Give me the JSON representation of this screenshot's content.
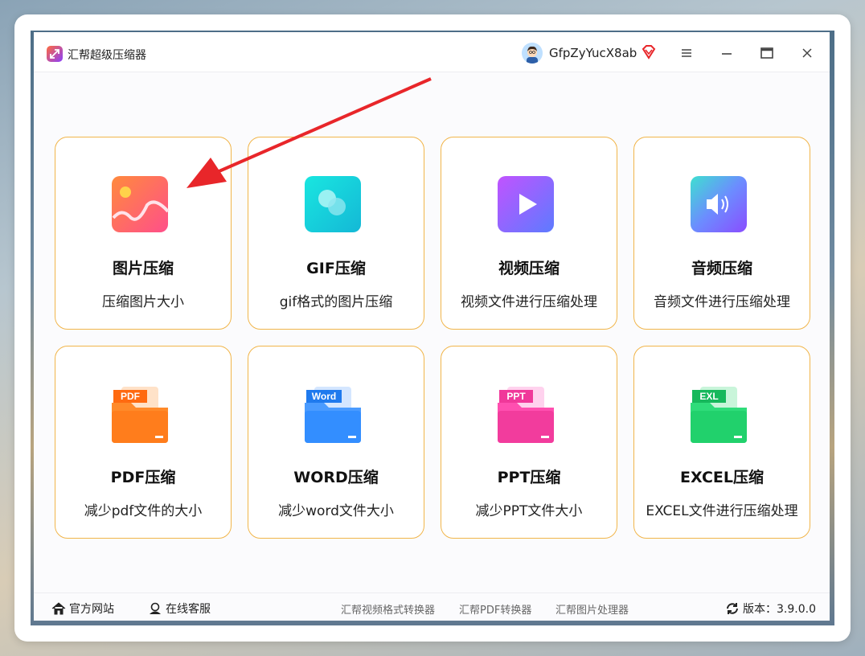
{
  "window": {
    "title": "汇帮超级压缩器"
  },
  "user": {
    "name": "GfpZyYucX8ab"
  },
  "cards": [
    {
      "title": "图片压缩",
      "desc": "压缩图片大小",
      "icon": "image-icon"
    },
    {
      "title": "GIF压缩",
      "desc": "gif格式的图片压缩",
      "icon": "gif-icon"
    },
    {
      "title": "视频压缩",
      "desc": "视频文件进行压缩处理",
      "icon": "video-play-icon"
    },
    {
      "title": "音频压缩",
      "desc": "音频文件进行压缩处理",
      "icon": "speaker-icon"
    },
    {
      "title": "PDF压缩",
      "desc": "减少pdf文件的大小",
      "icon": "pdf-folder-icon",
      "badge": "PDF"
    },
    {
      "title": "WORD压缩",
      "desc": "减少word文件大小",
      "icon": "word-folder-icon",
      "badge": "Word"
    },
    {
      "title": "PPT压缩",
      "desc": "减少PPT文件大小",
      "icon": "ppt-folder-icon",
      "badge": "PPT"
    },
    {
      "title": "EXCEL压缩",
      "desc": "EXCEL文件进行压缩处理",
      "icon": "excel-folder-icon",
      "badge": "EXL"
    }
  ],
  "footer": {
    "website": "官方网站",
    "support": "在线客服",
    "links": [
      "汇帮视频格式转换器",
      "汇帮PDF转换器",
      "汇帮图片处理器"
    ],
    "version_label": "版本：3.9.0.0"
  },
  "colors": {
    "card_border": "#f1b54a",
    "arrow": "#e8262a",
    "pdf": "#ff7a1a",
    "word": "#2f8cff",
    "ppt": "#f0389a",
    "excel": "#1fcf6a"
  }
}
